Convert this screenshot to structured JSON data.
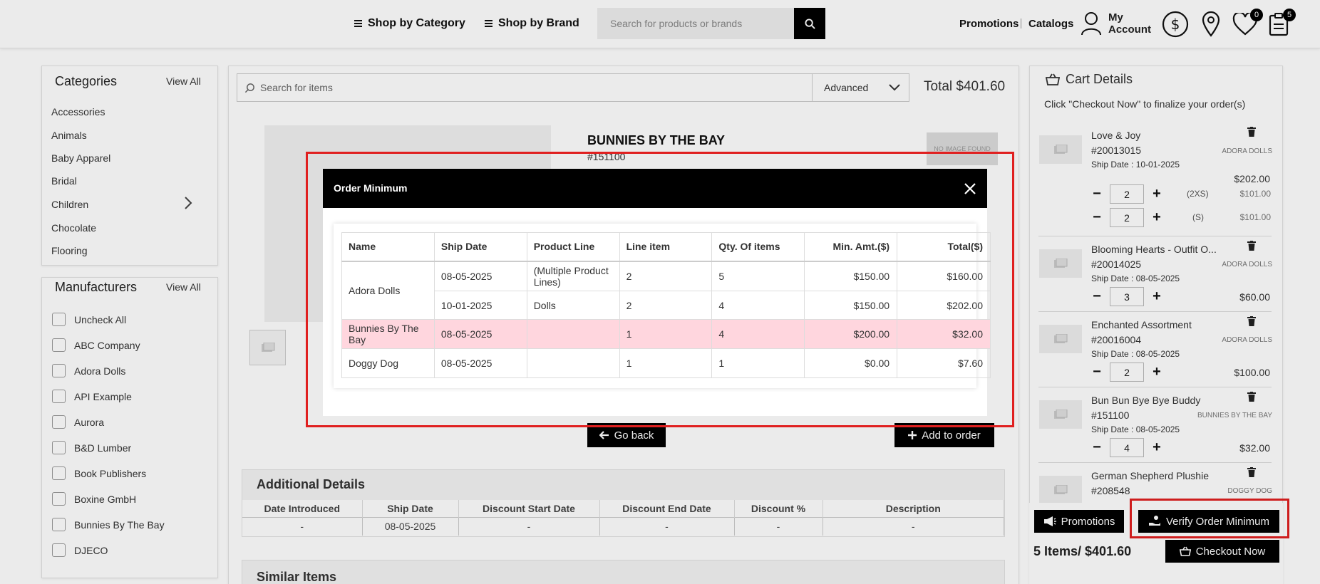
{
  "header": {
    "shop_by_category": "Shop by Category",
    "shop_by_brand": "Shop by Brand",
    "search_placeholder": "Search for products or brands",
    "promotions": "Promotions",
    "catalogs": "Catalogs",
    "my_account_line1": "My",
    "my_account_line2": "Account",
    "wishlist_count": "0",
    "cart_count": "5"
  },
  "sidebar": {
    "categories_title": "Categories",
    "categories_view_all": "View All",
    "categories": [
      "Accessories",
      "Animals",
      "Baby Apparel",
      "Bridal",
      "Children",
      "Chocolate",
      "Flooring"
    ],
    "manufacturers_title": "Manufacturers",
    "manufacturers_view_all": "View All",
    "manufacturers": [
      "Uncheck All",
      "ABC Company",
      "Adora Dolls",
      "API Example",
      "Aurora",
      "B&D Lumber",
      "Book Publishers",
      "Boxine GmbH",
      "Bunnies By The Bay",
      "DJECO"
    ]
  },
  "main": {
    "search_placeholder": "Search for items",
    "advanced_label": "Advanced",
    "total_label": "Total $401.60",
    "product_title": "BUNNIES BY THE BAY",
    "product_number": "#151100",
    "no_image": "NO IMAGE FOUND",
    "go_back": "Go back",
    "add_to_order": "Add to order",
    "additional_details_title": "Additional Details",
    "details_headers": [
      "Date Introduced",
      "Ship Date",
      "Discount Start Date",
      "Discount End Date",
      "Discount %",
      "Description"
    ],
    "details_values": [
      "-",
      "08-05-2025",
      "-",
      "-",
      "-",
      "-"
    ],
    "similar_items_title": "Similar Items"
  },
  "cart": {
    "title": "Cart Details",
    "subtitle": "Click \"Checkout Now\" to finalize your order(s)",
    "items": [
      {
        "name": "Love & Joy",
        "number": "#20013015",
        "brand": "ADORA DOLLS",
        "ship": "Ship Date : 10-01-2025",
        "price": "$202.00",
        "variants": [
          {
            "qty": "2",
            "size": "(2XS)",
            "price": "$101.00"
          },
          {
            "qty": "2",
            "size": "(S)",
            "price": "$101.00"
          }
        ]
      },
      {
        "name": "Blooming Hearts - Outfit O...",
        "number": "#20014025",
        "brand": "ADORA DOLLS",
        "ship": "Ship Date : 08-05-2025",
        "qty": "3",
        "price": "$60.00"
      },
      {
        "name": "Enchanted Assortment",
        "number": "#20016004",
        "brand": "ADORA DOLLS",
        "ship": "Ship Date : 08-05-2025",
        "qty": "2",
        "price": "$100.00"
      },
      {
        "name": "Bun Bun Bye Bye Buddy",
        "number": "#151100",
        "brand": "BUNNIES BY THE BAY",
        "ship": "Ship Date : 08-05-2025",
        "qty": "4",
        "price": "$32.00"
      },
      {
        "name": "German Shepherd Plushie",
        "number": "#208548",
        "brand": "DOGGY DOG"
      }
    ],
    "promotions_btn": "Promotions",
    "verify_btn": "Verify Order Minimum",
    "summary": "5 Items/ $401.60",
    "checkout_btn": "Checkout Now"
  },
  "modal": {
    "title": "Order Minimum",
    "columns": [
      "Name",
      "Ship Date",
      "Product Line",
      "Line item",
      "Qty. Of items",
      "Min. Amt.($)",
      "Total($)"
    ],
    "rows": [
      {
        "name": "Adora Dolls",
        "ship": "08-05-2025",
        "line": "(Multiple Product Lines)",
        "items": "2",
        "qty": "5",
        "min": "$150.00",
        "total": "$160.00"
      },
      {
        "name": "",
        "ship": "10-01-2025",
        "line": "Dolls",
        "items": "2",
        "qty": "4",
        "min": "$150.00",
        "total": "$202.00"
      },
      {
        "name": "Bunnies By The Bay",
        "ship": "08-05-2025",
        "line": "",
        "items": "1",
        "qty": "4",
        "min": "$200.00",
        "total": "$32.00"
      },
      {
        "name": "Doggy Dog",
        "ship": "08-05-2025",
        "line": "",
        "items": "1",
        "qty": "1",
        "min": "$0.00",
        "total": "$7.60"
      }
    ]
  },
  "colors": {
    "accent": "#000000",
    "highlight_row": "#ffd6de",
    "annotation": "#e02020"
  }
}
